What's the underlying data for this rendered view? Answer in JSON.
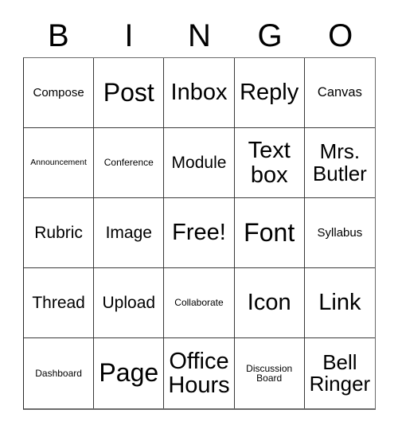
{
  "card": {
    "title": "BINGO",
    "header_letters": [
      "B",
      "I",
      "N",
      "G",
      "O"
    ],
    "free_space_label": "Free!",
    "size": "5x5",
    "colors": {
      "background": "#ffffff",
      "text": "#000000",
      "grid_line": "#3a3a3a",
      "outer_border": "#6b6b6b"
    },
    "rows": [
      [
        {
          "text": "Compose",
          "size": "md"
        },
        {
          "text": "Post",
          "size": "4xl"
        },
        {
          "text": "Inbox",
          "size": "3xl"
        },
        {
          "text": "Reply",
          "size": "3xl"
        },
        {
          "text": "Canvas",
          "size": "lg"
        }
      ],
      [
        {
          "text": "Announcement",
          "size": "xs"
        },
        {
          "text": "Conference",
          "size": "sm"
        },
        {
          "text": "Module",
          "size": "xl"
        },
        {
          "text": "Text box",
          "size": "3xl"
        },
        {
          "text": "Mrs. Butler",
          "size": "2xl"
        }
      ],
      [
        {
          "text": "Rubric",
          "size": "xl"
        },
        {
          "text": "Image",
          "size": "xl"
        },
        {
          "text": "Free!",
          "size": "3xl"
        },
        {
          "text": "Font",
          "size": "4xl"
        },
        {
          "text": "Syllabus",
          "size": "md"
        }
      ],
      [
        {
          "text": "Thread",
          "size": "xl"
        },
        {
          "text": "Upload",
          "size": "xl"
        },
        {
          "text": "Collaborate",
          "size": "sm"
        },
        {
          "text": "Icon",
          "size": "3xl"
        },
        {
          "text": "Link",
          "size": "3xl"
        }
      ],
      [
        {
          "text": "Dashboard",
          "size": "sm"
        },
        {
          "text": "Page",
          "size": "4xl"
        },
        {
          "text": "Office Hours",
          "size": "3xl"
        },
        {
          "text": "Discussion Board",
          "size": "sm"
        },
        {
          "text": "Bell Ringer",
          "size": "2xl"
        }
      ]
    ]
  }
}
